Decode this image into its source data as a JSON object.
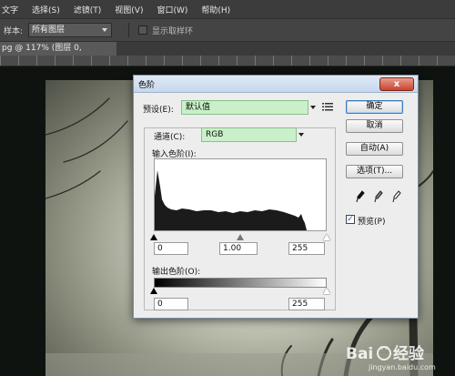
{
  "menubar": {
    "items": [
      "文字",
      "选择(S)",
      "滤镜(T)",
      "视图(V)",
      "窗口(W)",
      "帮助(H)"
    ]
  },
  "options_bar": {
    "sample_label": "样本:",
    "sample_value": "所有图层",
    "show_ring_label": "显示取样环"
  },
  "document_tab": {
    "title": "pg @ 117% (图层 0, RGB/8#) *",
    "close": "×"
  },
  "dialog": {
    "title": "色阶",
    "preset_label": "预设(E):",
    "preset_value": "默认值",
    "preset_menu_icon": "list-menu-icon",
    "channel_label": "通道(C):",
    "channel_value": "RGB",
    "input_levels_label": "输入色阶(I):",
    "input_black": "0",
    "input_gamma": "1.00",
    "input_white": "255",
    "output_levels_label": "输出色阶(O):",
    "output_black": "0",
    "output_white": "255",
    "buttons": {
      "ok": "确定",
      "cancel": "取消",
      "auto": "自动(A)",
      "options": "选项(T)..."
    },
    "preview_label": "预览(P)",
    "preview_checked": true,
    "close_label": "x"
  },
  "watermark": {
    "text": "Baidu 经验",
    "url": "jingyan.baidu.com"
  },
  "colors": {
    "accent": "#3d7bbf",
    "field_green": "#c9f0c9",
    "chrome_dark": "#3c3c3c"
  }
}
